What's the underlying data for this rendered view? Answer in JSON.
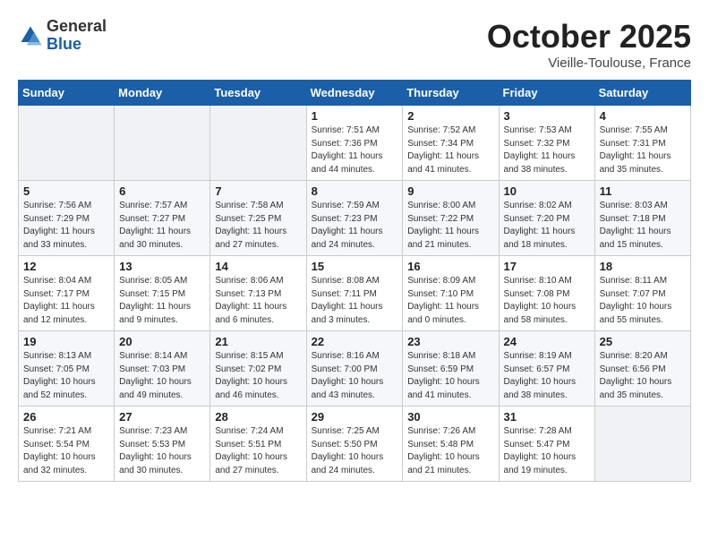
{
  "header": {
    "logo_general": "General",
    "logo_blue": "Blue",
    "month": "October 2025",
    "location": "Vieille-Toulouse, France"
  },
  "days_of_week": [
    "Sunday",
    "Monday",
    "Tuesday",
    "Wednesday",
    "Thursday",
    "Friday",
    "Saturday"
  ],
  "weeks": [
    [
      {
        "day": "",
        "info": ""
      },
      {
        "day": "",
        "info": ""
      },
      {
        "day": "",
        "info": ""
      },
      {
        "day": "1",
        "info": "Sunrise: 7:51 AM\nSunset: 7:36 PM\nDaylight: 11 hours\nand 44 minutes."
      },
      {
        "day": "2",
        "info": "Sunrise: 7:52 AM\nSunset: 7:34 PM\nDaylight: 11 hours\nand 41 minutes."
      },
      {
        "day": "3",
        "info": "Sunrise: 7:53 AM\nSunset: 7:32 PM\nDaylight: 11 hours\nand 38 minutes."
      },
      {
        "day": "4",
        "info": "Sunrise: 7:55 AM\nSunset: 7:31 PM\nDaylight: 11 hours\nand 35 minutes."
      }
    ],
    [
      {
        "day": "5",
        "info": "Sunrise: 7:56 AM\nSunset: 7:29 PM\nDaylight: 11 hours\nand 33 minutes."
      },
      {
        "day": "6",
        "info": "Sunrise: 7:57 AM\nSunset: 7:27 PM\nDaylight: 11 hours\nand 30 minutes."
      },
      {
        "day": "7",
        "info": "Sunrise: 7:58 AM\nSunset: 7:25 PM\nDaylight: 11 hours\nand 27 minutes."
      },
      {
        "day": "8",
        "info": "Sunrise: 7:59 AM\nSunset: 7:23 PM\nDaylight: 11 hours\nand 24 minutes."
      },
      {
        "day": "9",
        "info": "Sunrise: 8:00 AM\nSunset: 7:22 PM\nDaylight: 11 hours\nand 21 minutes."
      },
      {
        "day": "10",
        "info": "Sunrise: 8:02 AM\nSunset: 7:20 PM\nDaylight: 11 hours\nand 18 minutes."
      },
      {
        "day": "11",
        "info": "Sunrise: 8:03 AM\nSunset: 7:18 PM\nDaylight: 11 hours\nand 15 minutes."
      }
    ],
    [
      {
        "day": "12",
        "info": "Sunrise: 8:04 AM\nSunset: 7:17 PM\nDaylight: 11 hours\nand 12 minutes."
      },
      {
        "day": "13",
        "info": "Sunrise: 8:05 AM\nSunset: 7:15 PM\nDaylight: 11 hours\nand 9 minutes."
      },
      {
        "day": "14",
        "info": "Sunrise: 8:06 AM\nSunset: 7:13 PM\nDaylight: 11 hours\nand 6 minutes."
      },
      {
        "day": "15",
        "info": "Sunrise: 8:08 AM\nSunset: 7:11 PM\nDaylight: 11 hours\nand 3 minutes."
      },
      {
        "day": "16",
        "info": "Sunrise: 8:09 AM\nSunset: 7:10 PM\nDaylight: 11 hours\nand 0 minutes."
      },
      {
        "day": "17",
        "info": "Sunrise: 8:10 AM\nSunset: 7:08 PM\nDaylight: 10 hours\nand 58 minutes."
      },
      {
        "day": "18",
        "info": "Sunrise: 8:11 AM\nSunset: 7:07 PM\nDaylight: 10 hours\nand 55 minutes."
      }
    ],
    [
      {
        "day": "19",
        "info": "Sunrise: 8:13 AM\nSunset: 7:05 PM\nDaylight: 10 hours\nand 52 minutes."
      },
      {
        "day": "20",
        "info": "Sunrise: 8:14 AM\nSunset: 7:03 PM\nDaylight: 10 hours\nand 49 minutes."
      },
      {
        "day": "21",
        "info": "Sunrise: 8:15 AM\nSunset: 7:02 PM\nDaylight: 10 hours\nand 46 minutes."
      },
      {
        "day": "22",
        "info": "Sunrise: 8:16 AM\nSunset: 7:00 PM\nDaylight: 10 hours\nand 43 minutes."
      },
      {
        "day": "23",
        "info": "Sunrise: 8:18 AM\nSunset: 6:59 PM\nDaylight: 10 hours\nand 41 minutes."
      },
      {
        "day": "24",
        "info": "Sunrise: 8:19 AM\nSunset: 6:57 PM\nDaylight: 10 hours\nand 38 minutes."
      },
      {
        "day": "25",
        "info": "Sunrise: 8:20 AM\nSunset: 6:56 PM\nDaylight: 10 hours\nand 35 minutes."
      }
    ],
    [
      {
        "day": "26",
        "info": "Sunrise: 7:21 AM\nSunset: 5:54 PM\nDaylight: 10 hours\nand 32 minutes."
      },
      {
        "day": "27",
        "info": "Sunrise: 7:23 AM\nSunset: 5:53 PM\nDaylight: 10 hours\nand 30 minutes."
      },
      {
        "day": "28",
        "info": "Sunrise: 7:24 AM\nSunset: 5:51 PM\nDaylight: 10 hours\nand 27 minutes."
      },
      {
        "day": "29",
        "info": "Sunrise: 7:25 AM\nSunset: 5:50 PM\nDaylight: 10 hours\nand 24 minutes."
      },
      {
        "day": "30",
        "info": "Sunrise: 7:26 AM\nSunset: 5:48 PM\nDaylight: 10 hours\nand 21 minutes."
      },
      {
        "day": "31",
        "info": "Sunrise: 7:28 AM\nSunset: 5:47 PM\nDaylight: 10 hours\nand 19 minutes."
      },
      {
        "day": "",
        "info": ""
      }
    ]
  ]
}
